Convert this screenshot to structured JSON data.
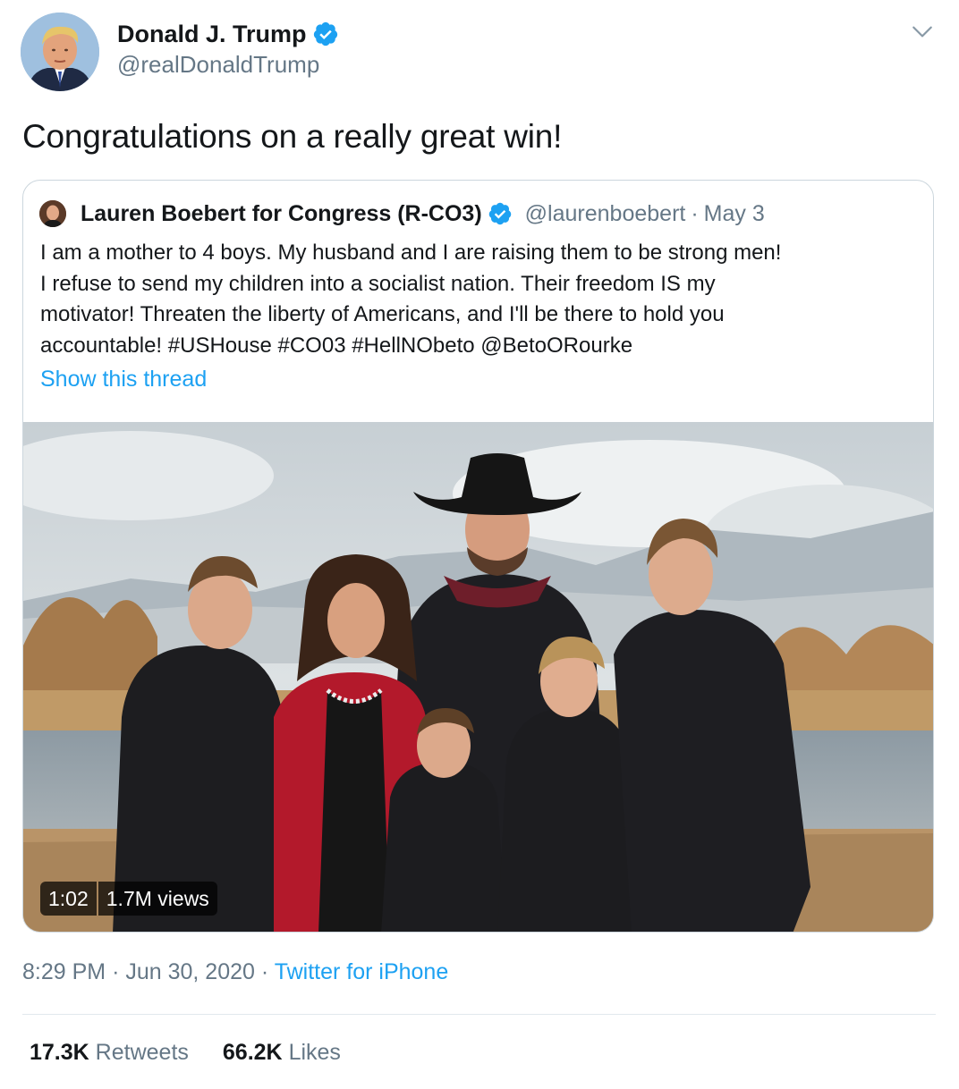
{
  "author": {
    "name": "Donald J. Trump",
    "handle": "@realDonaldTrump"
  },
  "tweet_text": "Congratulations on a really great win!",
  "quoted_tweet": {
    "name": "Lauren Boebert for Congress (R-CO3)",
    "handle": "@laurenboebert",
    "separator": "·",
    "date": "May 3",
    "lines": [
      "I am a mother to 4 boys. My husband and I are raising them to be strong men!",
      "I refuse to send my children into a socialist nation. Their freedom IS my",
      "motivator! Threaten the liberty of Americans, and I'll be there to hold you",
      "accountable! #USHouse #CO03 #HellNObeto @BetoORourke"
    ],
    "show_thread": "Show this thread",
    "video": {
      "duration": "1:02",
      "views": "1.7M views"
    }
  },
  "meta": {
    "time": "8:29 PM",
    "sep1": "·",
    "date": "Jun 30, 2020",
    "sep2": "·",
    "source": "Twitter for iPhone"
  },
  "stats": {
    "retweets_count": "17.3K",
    "retweets_label": "Retweets",
    "likes_count": "66.2K",
    "likes_label": "Likes"
  },
  "icons": {
    "verified": "verified-badge-icon",
    "more": "chevron-down-icon"
  },
  "colors": {
    "link": "#1da1f2",
    "secondary_text": "#657786",
    "primary_text": "#14171a",
    "border": "#ccd6dd"
  }
}
